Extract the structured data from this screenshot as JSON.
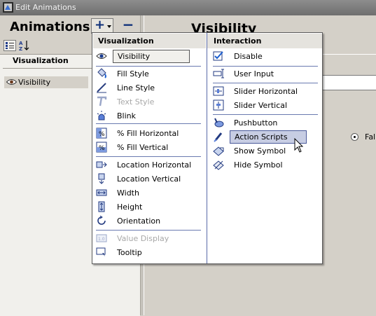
{
  "window": {
    "title": "Edit Animations"
  },
  "left": {
    "heading": "Animations",
    "add_button": "+",
    "remove_button": "−",
    "list_header": "Visualization",
    "list_items": [
      {
        "label": "Visibility",
        "icon": "eye-icon"
      }
    ]
  },
  "right": {
    "heading": "Visibility",
    "radio_label": "Fal"
  },
  "menu": {
    "visualization_header": "Visualization",
    "interaction_header": "Interaction",
    "visualization": [
      {
        "label": "Visibility",
        "icon": "eye-icon",
        "selected": true
      },
      {
        "label": "Fill Style",
        "icon": "paint-bucket-icon"
      },
      {
        "label": "Line Style",
        "icon": "pen-line-icon"
      },
      {
        "label": "Text Style",
        "icon": "text-style-icon",
        "disabled": true
      },
      {
        "label": "Blink",
        "icon": "blink-light-icon"
      },
      {
        "label": "% Fill Horizontal",
        "icon": "percent-fill-horizontal-icon"
      },
      {
        "label": "% Fill Vertical",
        "icon": "percent-fill-vertical-icon"
      },
      {
        "label": "Location Horizontal",
        "icon": "location-horizontal-icon"
      },
      {
        "label": "Location Vertical",
        "icon": "location-vertical-icon"
      },
      {
        "label": "Width",
        "icon": "width-icon"
      },
      {
        "label": "Height",
        "icon": "height-icon"
      },
      {
        "label": "Orientation",
        "icon": "orientation-icon"
      },
      {
        "label": "Value Display",
        "icon": "value-display-icon",
        "disabled": true
      },
      {
        "label": "Tooltip",
        "icon": "tooltip-icon"
      }
    ],
    "interaction": [
      {
        "label": "Disable",
        "icon": "disable-checkbox-icon"
      },
      {
        "label": "User Input",
        "icon": "user-input-icon"
      },
      {
        "label": "Slider Horizontal",
        "icon": "slider-horizontal-icon"
      },
      {
        "label": "Slider Vertical",
        "icon": "slider-vertical-icon"
      },
      {
        "label": "Pushbutton",
        "icon": "pushbutton-icon"
      },
      {
        "label": "Action Scripts",
        "icon": "action-scripts-icon",
        "highlighted": true
      },
      {
        "label": "Show Symbol",
        "icon": "show-symbol-icon"
      },
      {
        "label": "Hide Symbol",
        "icon": "hide-symbol-icon"
      }
    ]
  }
}
